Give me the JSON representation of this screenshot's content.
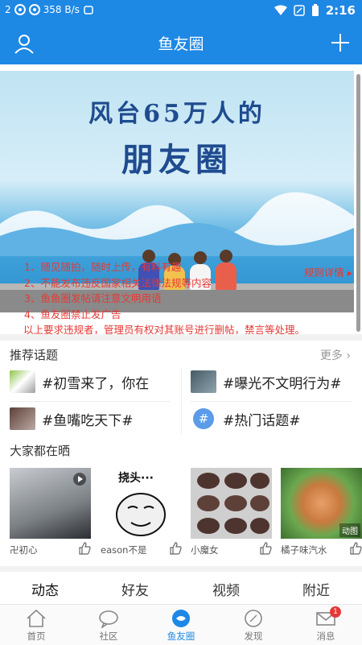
{
  "status": {
    "left_text": "2",
    "speed": "358 B/s",
    "time": "2:16"
  },
  "nav": {
    "title": "鱼友圈"
  },
  "banner": {
    "headline": "风台65万人的",
    "headline2": "朋友圈",
    "rules": [
      "1、随见随拍，随时上传，有料有趣",
      "2、不能发布违反国家相关法律法规等内容",
      "3、鱼鱼圈发帖请注意文明用语",
      "4、鱼友圈禁止发广告",
      "以上要求违规者，管理员有权对其账号进行删帖，禁言等处理。"
    ],
    "rules_detail": "规则详情 ▸"
  },
  "topics": {
    "title": "推荐话题",
    "more": "更多",
    "items": [
      {
        "label": "#初雪来了，你在"
      },
      {
        "label": "#曝光不文明行为#"
      },
      {
        "label": "#鱼嘴吃天下#"
      },
      {
        "label": "#热门话题#"
      }
    ]
  },
  "showcase": {
    "title": "大家都在晒",
    "cards": [
      {
        "name": "卍初心",
        "badge": ""
      },
      {
        "name": "eason不是",
        "badge": "",
        "meme_text": "挠头···"
      },
      {
        "name": "小魔女",
        "badge": ""
      },
      {
        "name": "橘子味汽水",
        "badge": "动图"
      }
    ]
  },
  "feed_tabs": [
    "动态",
    "好友",
    "视频",
    "附近"
  ],
  "bottom_nav": {
    "items": [
      {
        "label": "首页"
      },
      {
        "label": "社区"
      },
      {
        "label": "鱼友圈"
      },
      {
        "label": "发现"
      },
      {
        "label": "消息",
        "badge": "1"
      }
    ]
  },
  "colors": {
    "brand": "#1e88e5",
    "rules_red": "#e53935"
  }
}
